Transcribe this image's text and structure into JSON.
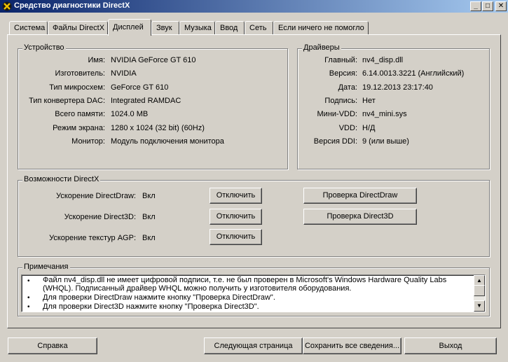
{
  "window": {
    "title": "Средство диагностики DirectX",
    "minimize_glyph": "_",
    "maximize_glyph": "□",
    "close_glyph": "✕"
  },
  "tabs": [
    {
      "label": "Система"
    },
    {
      "label": "Файлы DirectX"
    },
    {
      "label": "Дисплей",
      "active": true
    },
    {
      "label": "Звук"
    },
    {
      "label": "Музыка"
    },
    {
      "label": "Ввод"
    },
    {
      "label": "Сеть"
    },
    {
      "label": "Если ничего не помогло"
    }
  ],
  "device": {
    "title": "Устройство",
    "rows": [
      {
        "label": "Имя:",
        "value": "NVIDIA GeForce GT 610"
      },
      {
        "label": "Изготовитель:",
        "value": "NVIDIA"
      },
      {
        "label": "Тип микросхем:",
        "value": "GeForce GT 610"
      },
      {
        "label": "Тип конвертера DAC:",
        "value": "Integrated RAMDAC"
      },
      {
        "label": "Всего памяти:",
        "value": "1024.0 MB"
      },
      {
        "label": "Режим экрана:",
        "value": "1280 x 1024 (32 bit) (60Hz)"
      },
      {
        "label": "Монитор:",
        "value": "Модуль подключения монитора"
      }
    ]
  },
  "drivers": {
    "title": "Драйверы",
    "rows": [
      {
        "label": "Главный:",
        "value": "nv4_disp.dll"
      },
      {
        "label": "Версия:",
        "value": "6.14.0013.3221 (Английский)"
      },
      {
        "label": "Дата:",
        "value": "19.12.2013 23:17:40"
      },
      {
        "label": "Подпись:",
        "value": "Нет"
      },
      {
        "label": "Мини-VDD:",
        "value": "nv4_mini.sys"
      },
      {
        "label": "VDD:",
        "value": "Н/Д"
      },
      {
        "label": "Версия DDI:",
        "value": "9 (или выше)"
      }
    ]
  },
  "directx": {
    "title": "Возможности DirectX",
    "rows": [
      {
        "label": "Ускорение DirectDraw:",
        "value": "Вкл",
        "button": "Отключить"
      },
      {
        "label": "Ускорение Direct3D:",
        "value": "Вкл",
        "button": "Отключить"
      },
      {
        "label": "Ускорение текстур AGP:",
        "value": "Вкл",
        "button": "Отключить"
      }
    ],
    "test_directdraw": "Проверка DirectDraw",
    "test_direct3d": "Проверка Direct3D"
  },
  "notes": {
    "title": "Примечания",
    "bullet": "•",
    "lines": [
      "Файл nv4_disp.dll не имеет цифровой подписи, т.е. не был проверен в Microsoft's Windows Hardware Quality Labs",
      "(WHQL).  Подписанный драйвер WHQL можно получить у изготовителя оборудования.",
      "Для проверки DirectDraw нажмите кнопку \"Проверка DirectDraw\".",
      "Для проверки Direct3D нажмите кнопку \"Проверка Direct3D\"."
    ],
    "scroll_up": "▲",
    "scroll_down": "▼"
  },
  "footer": {
    "help": "Справка",
    "next_page": "Следующая страница",
    "save_all": "Сохранить все сведения...",
    "exit": "Выход"
  }
}
